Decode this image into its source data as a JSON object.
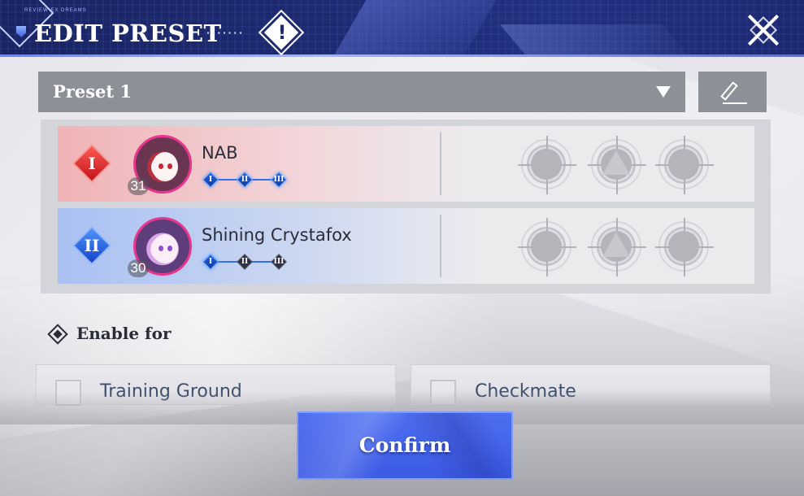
{
  "header": {
    "title": "EDIT PRESET",
    "dots": "·······",
    "small_text": "REVIEW  EX  DREAMS"
  },
  "preset": {
    "selected": "Preset 1"
  },
  "team": [
    {
      "rank": "I",
      "name": "NAB",
      "level": "31",
      "skills": [
        "I",
        "II",
        "III"
      ],
      "skill_states": [
        "on",
        "on",
        "on"
      ]
    },
    {
      "rank": "II",
      "name": "Shining Crystafox",
      "level": "30",
      "skills": [
        "I",
        "II",
        "III"
      ],
      "skill_states": [
        "on",
        "off",
        "off"
      ]
    }
  ],
  "enable_for": {
    "label": "Enable for",
    "options": [
      {
        "label": "Training Ground",
        "checked": false
      },
      {
        "label": "Checkmate",
        "checked": false
      }
    ]
  },
  "confirm_label": "Confirm",
  "colors": {
    "header_bg": "#1d2a70",
    "confirm_bg": "#4063ea",
    "rank1": "#d8222a",
    "rank2": "#2a64e0",
    "avatar_border": "#e9358e"
  }
}
